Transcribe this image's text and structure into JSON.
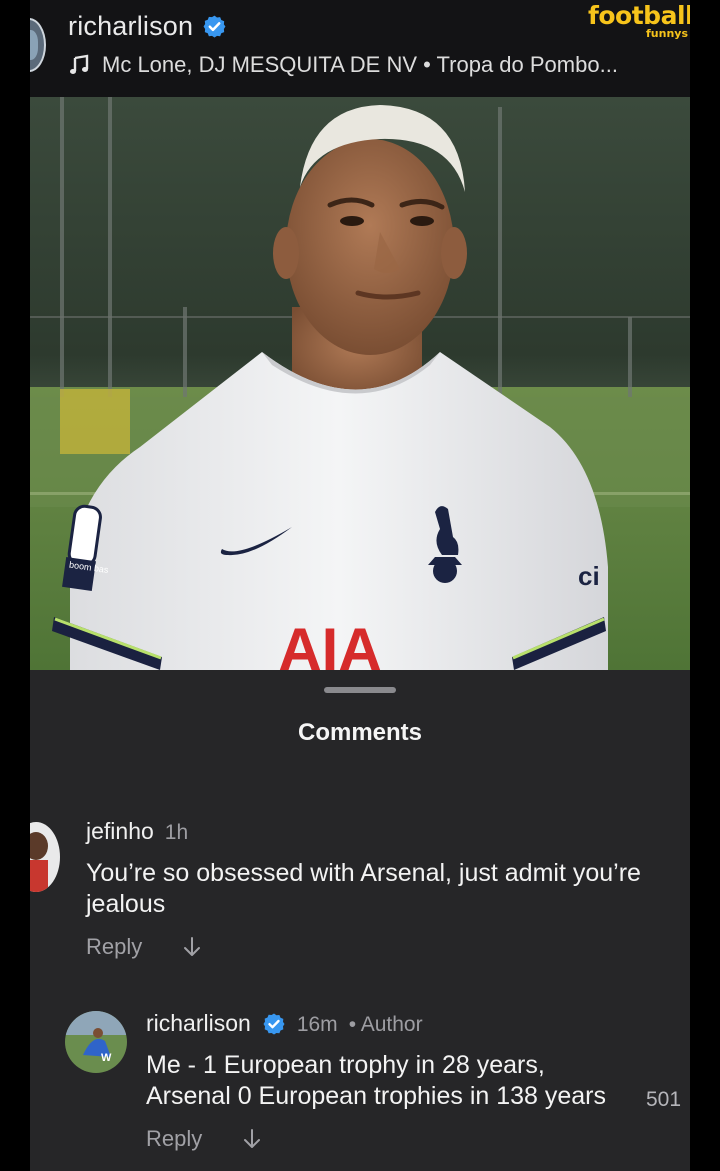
{
  "post": {
    "username": "richarlison",
    "music": "Mc Lone, DJ MESQUITA DE NV • Tropa do Pombo..."
  },
  "brand": {
    "name": "footballl",
    "sub": "funnys",
    "color": "#f7c41b"
  },
  "photo": {
    "shirt_sponsor": "AIA",
    "sleeve_badge": "boom bas",
    "sleeve_partner": "ci"
  },
  "comments_sheet": {
    "title": "Comments",
    "comments": [
      {
        "username": "jefinho",
        "time": "1h",
        "text": "You’re so obsessed with Arsenal, just admit you’re jealous",
        "reply_label": "Reply"
      },
      {
        "username": "richarlison",
        "time": "16m",
        "author_tag": "• Author",
        "text": "Me - 1 European trophy in 28 years, Arsenal 0 European trophies in 138 years",
        "reply_label": "Reply",
        "like_count": "501"
      }
    ]
  },
  "colors": {
    "verified_blue": "#3897f0",
    "sheet_bg": "#262628"
  },
  "icons": {
    "verified": "verified-badge-icon",
    "music": "music-note-icon",
    "translate": "down-arrow-icon"
  }
}
